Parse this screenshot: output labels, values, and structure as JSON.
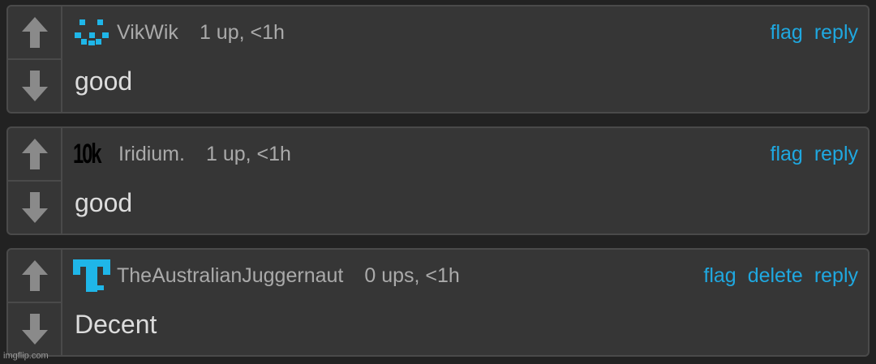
{
  "comments": [
    {
      "username": "VikWik",
      "meta": "1 up, <1h",
      "body": "good",
      "avatar_icon": "pixel-face-icon",
      "actions": [
        "flag",
        "reply"
      ]
    },
    {
      "username": "Iridium.",
      "meta": "1 up, <1h",
      "body": "good",
      "avatar_icon": "10k-badge-icon",
      "avatar_text": "10k",
      "actions": [
        "flag",
        "reply"
      ]
    },
    {
      "username": "TheAustralianJuggernaut",
      "meta": "0 ups, <1h",
      "body": "Decent",
      "avatar_icon": "pixel-t-icon",
      "actions": [
        "flag",
        "delete",
        "reply"
      ]
    }
  ],
  "watermark": "imgflip.com",
  "colors": {
    "background": "#222222",
    "card": "#363636",
    "border": "#4a4a4a",
    "accent": "#1fa8e0",
    "muted_text": "#aaaaaa",
    "body_text": "#dcdcdc"
  }
}
